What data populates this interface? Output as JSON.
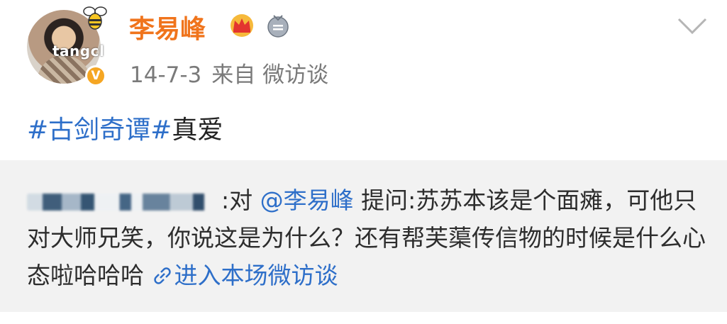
{
  "header": {
    "avatar_watermark": "tangcl",
    "verified_mark": "V",
    "username": "李易峰",
    "date": "14-7-3",
    "source": "来自 微访谈",
    "icons": [
      "bee-icon",
      "crown-icon",
      "medal-icon",
      "chevron-down-icon"
    ]
  },
  "post": {
    "topic": "#古剑奇谭#",
    "text": "真爱"
  },
  "retweet": {
    "prefix": ":对 ",
    "mention": "@李易峰",
    "body": " 提问:苏苏本该是个面瘫，可他只对大师兄笑，你说这是为什么？还有帮芙蕖传信物的时候是什么心态啦哈哈哈 ",
    "link": "进入本场微访谈"
  },
  "colors": {
    "username": "#f0741c",
    "link": "#2e6fc9",
    "meta": "#7a7a7a",
    "retweet_bg": "#f2f2f2"
  }
}
